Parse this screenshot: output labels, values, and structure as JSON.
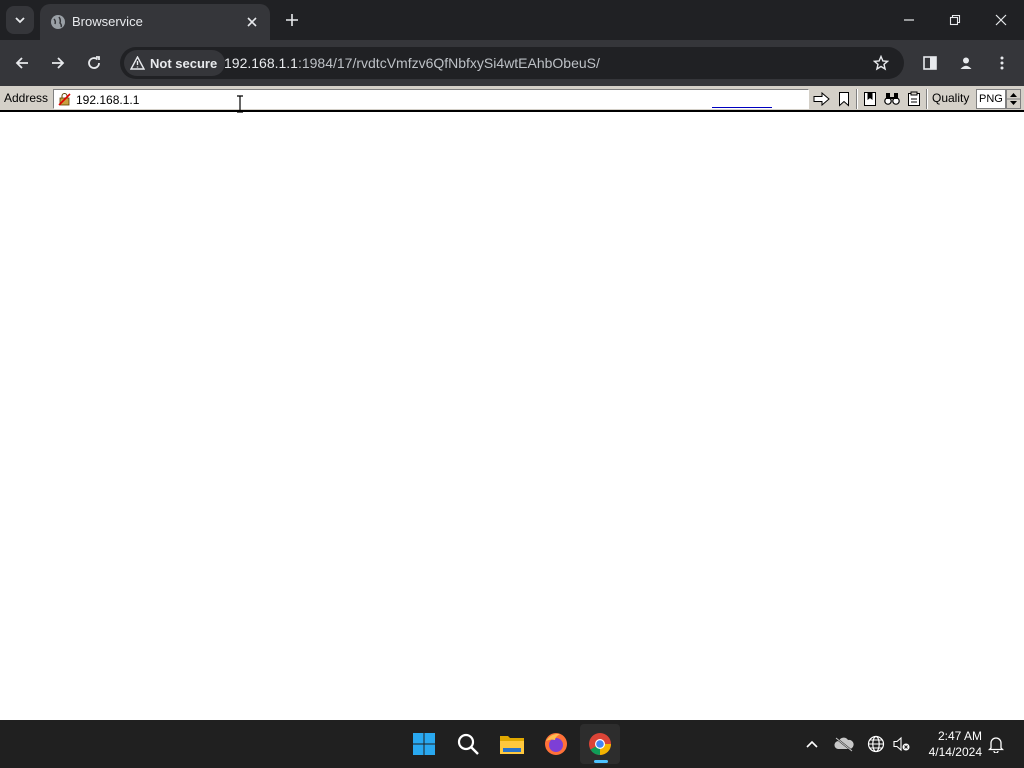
{
  "browser": {
    "tab": {
      "title": "Browservice"
    },
    "omnibox": {
      "security_label": "Not secure",
      "url_host": "192.168.1.1",
      "url_rest": ":1984/17/rvdtcVmfzv6QfNbfxySi4wtEAhbObeuS/"
    }
  },
  "browservice": {
    "address_label": "Address",
    "address_value": "192.168.1.1",
    "quality_label": "Quality",
    "quality_value": "PNG"
  },
  "taskbar": {
    "apps": [
      "start",
      "search",
      "file-explorer",
      "firefox",
      "chrome"
    ],
    "time": "2:47 AM",
    "date": "4/14/2024"
  },
  "colors": {
    "tabstrip_bg": "#202124",
    "toolbar_bg": "#35363a",
    "browservice_bar_bg": "#d4d0c8",
    "taskbar_bg": "#202020",
    "accent": "#4cc2ff"
  }
}
